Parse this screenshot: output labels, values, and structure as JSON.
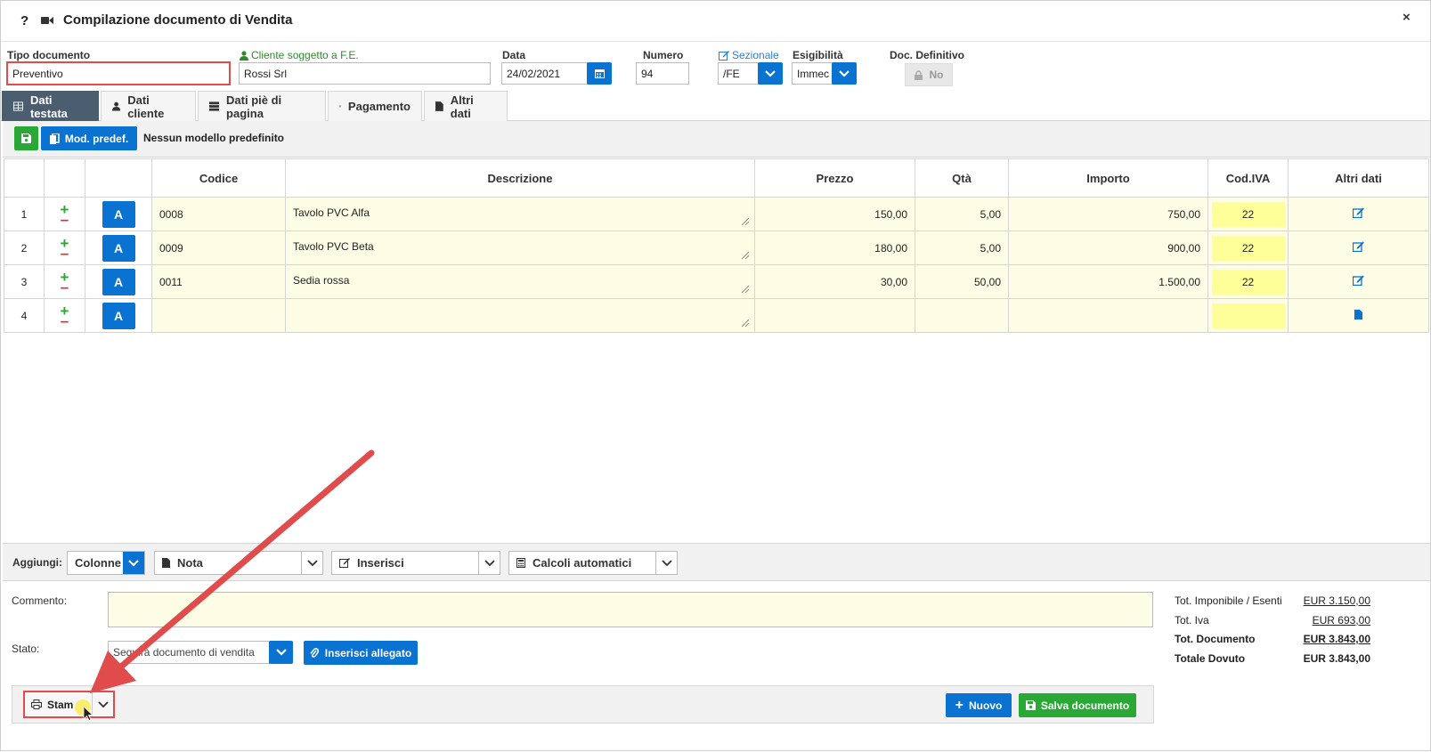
{
  "window": {
    "help_label": "?",
    "title": "Compilazione documento di Vendita",
    "close_label": "×"
  },
  "header": {
    "tipo_label": "Tipo documento",
    "tipo_value": "Preventivo",
    "cliente_label": "Cliente soggetto a F.E.",
    "cliente_value": "Rossi Srl",
    "data_label": "Data",
    "data_value": "24/02/2021",
    "numero_label": "Numero",
    "numero_value": "94",
    "sezionale_label": "Sezionale",
    "sezionale_value": "/FE",
    "esigibilita_label": "Esigibilità",
    "esigibilita_value": "Immec",
    "docdef_label": "Doc. Definitivo",
    "docdef_value": "No"
  },
  "tabs": [
    {
      "label": "Dati testata",
      "icon": "table-icon"
    },
    {
      "label": "Dati cliente",
      "icon": "user-icon"
    },
    {
      "label": "Dati piè di pagina",
      "icon": "list-icon"
    },
    {
      "label": "Pagamento",
      "icon": "calendar-icon"
    },
    {
      "label": "Altri dati",
      "icon": "file-icon"
    }
  ],
  "toolbar": {
    "model_button": "Mod. predef.",
    "model_text": "Nessun modello predefinito"
  },
  "grid": {
    "columns": [
      "Codice",
      "Descrizione",
      "Prezzo",
      "Qtà",
      "Importo",
      "Cod.IVA",
      "Altri dati"
    ],
    "a_label": "A",
    "plus": "+",
    "minus": "–",
    "rows": [
      {
        "n": "1",
        "codice": "0008",
        "descrizione": "Tavolo PVC Alfa",
        "prezzo": "150,00",
        "qta": "5,00",
        "importo": "750,00",
        "iva": "22"
      },
      {
        "n": "2",
        "codice": "0009",
        "descrizione": "Tavolo PVC Beta",
        "prezzo": "180,00",
        "qta": "5,00",
        "importo": "900,00",
        "iva": "22"
      },
      {
        "n": "3",
        "codice": "0011",
        "descrizione": "Sedia rossa",
        "prezzo": "30,00",
        "qta": "50,00",
        "importo": "1.500,00",
        "iva": "22"
      },
      {
        "n": "4",
        "codice": "",
        "descrizione": "",
        "prezzo": "",
        "qta": "",
        "importo": "",
        "iva": ""
      }
    ]
  },
  "addbar": {
    "label": "Aggiungi:",
    "colonne": "Colonne",
    "nota": "Nota",
    "inserisci": "Inserisci",
    "calcoli": "Calcoli automatici"
  },
  "footer": {
    "commento_label": "Commento:",
    "stato_label": "Stato:",
    "stato_value": "Sequirà documento di vendita",
    "allegato_button": "Inserisci allegato",
    "stampa_button": "Stam",
    "nuovo_button": "Nuovo",
    "salva_button": "Salva documento"
  },
  "totals": {
    "imponibile_label": "Tot. Imponibile / Esenti",
    "imponibile_value": "EUR 3.150,00",
    "iva_label": "Tot. Iva",
    "iva_value": "EUR 693,00",
    "documento_label": "Tot. Documento",
    "documento_value": "EUR 3.843,00",
    "dovuto_label": "Totale Dovuto",
    "dovuto_value": "EUR 3.843,00"
  },
  "colors": {
    "accent_blue": "#0a72d1",
    "green": "#2aa836",
    "annotation_red": "#e04b4b",
    "active_tab": "#4a5e6f",
    "row_yellow": "#fdfde6",
    "iva_yellow": "#ffff99"
  }
}
